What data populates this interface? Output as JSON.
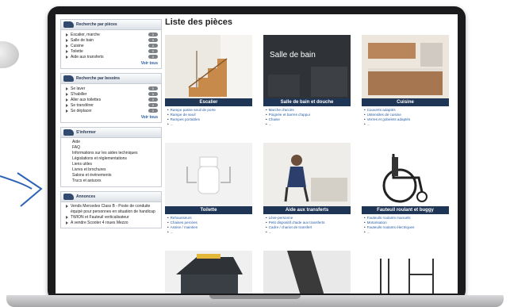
{
  "sidebar": {
    "panels": [
      {
        "title": "Recherche par pièces",
        "items": [
          {
            "label": "Escalier, marche",
            "count": "0"
          },
          {
            "label": "Salle de bain",
            "count": "0"
          },
          {
            "label": "Cuisine",
            "count": "0"
          },
          {
            "label": "Toilette",
            "count": "0"
          },
          {
            "label": "Aide aux transferts",
            "count": "0"
          }
        ],
        "more": "Voir tous"
      },
      {
        "title": "Recherche par besoins",
        "items": [
          {
            "label": "Se laver",
            "count": "0"
          },
          {
            "label": "S'habiller",
            "count": "0"
          },
          {
            "label": "Aller aux toilettes",
            "count": "0"
          },
          {
            "label": "Se transférer",
            "count": "0"
          },
          {
            "label": "Se déplacer",
            "count": "0"
          }
        ],
        "more": "Voir tous"
      },
      {
        "title": "S'informer",
        "items": [
          "Aide",
          "FAQ",
          "Informations sur les aides techniques",
          "Législations et réglementations",
          "Liens utiles",
          "Livres et brochures",
          "Salons et événements",
          "Trucs et astuces"
        ]
      },
      {
        "title": "Annonces",
        "items": [
          "Vends Mercedes Class B - Poste de conduite équipé pour personnes en situation de handicap",
          "TWION et Fauteuil verticalisateur",
          "A vendre Scooter 4 roues Mezzo"
        ]
      }
    ]
  },
  "main": {
    "title": "Liste des pièces",
    "tiles": [
      {
        "name": "Escalier",
        "links": [
          "Rampe passe seuil de porte",
          "Rampe de seuil",
          "Rampes portables",
          "..."
        ]
      },
      {
        "name": "Salle de bain et douche",
        "photo_text": "Salle de bain",
        "links": [
          "Marche d'accès",
          "Poignée et barres d'appui",
          "Chaise",
          "..."
        ]
      },
      {
        "name": "Cuisine",
        "links": [
          "Couverts adaptés",
          "Ustensiles de cuisine",
          "Verres et gobelets adaptés",
          "..."
        ]
      },
      {
        "name": "Toilette",
        "links": [
          "Rehausseurs",
          "Chaises percées",
          "Assise / maintien",
          "..."
        ]
      },
      {
        "name": "Aide aux transferts",
        "links": [
          "Lève-personne",
          "Petit dispositif d'aide aux transferts",
          "Cadre / chariot de transfert",
          "..."
        ]
      },
      {
        "name": "Fauteuil roulant et buggy",
        "links": [
          "Fauteuils roulants manuels",
          "Motorisation",
          "Fauteuils roulants électriques",
          "..."
        ]
      }
    ]
  },
  "colors": {
    "caption_bar": "#1f3556",
    "link": "#2a5fa5",
    "laptop_frame": "#1b1b1d",
    "arrow": "#2c63b5"
  }
}
